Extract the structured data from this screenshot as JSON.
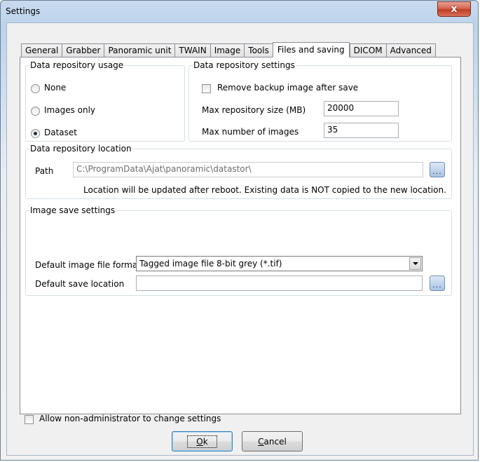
{
  "window": {
    "title": "Settings",
    "close_label": "x"
  },
  "tabs": [
    {
      "label": "General"
    },
    {
      "label": "Grabber"
    },
    {
      "label": "Panoramic unit"
    },
    {
      "label": "TWAIN"
    },
    {
      "label": "Image"
    },
    {
      "label": "Tools"
    },
    {
      "label": "Files and saving"
    },
    {
      "label": "DICOM"
    },
    {
      "label": "Advanced"
    }
  ],
  "active_tab": "Files and saving",
  "repo_usage": {
    "legend": "Data repository usage",
    "options": [
      {
        "label": "None",
        "selected": false
      },
      {
        "label": "Images only",
        "selected": false
      },
      {
        "label": "Dataset",
        "selected": true
      }
    ]
  },
  "repo_settings": {
    "legend": "Data repository settings",
    "remove_backup_label": "Remove backup image after save",
    "remove_backup_checked": false,
    "max_size_label": "Max repository size (MB)",
    "max_size_value": "20000",
    "max_images_label": "Max number of images",
    "max_images_value": "35"
  },
  "repo_location": {
    "legend": "Data repository location",
    "path_label": "Path",
    "path_value": "C:\\ProgramData\\Ajat\\panoramic\\datastor\\",
    "browse_label": "...",
    "note": "Location will be updated after reboot. Existing data is NOT copied to the new location."
  },
  "image_save": {
    "legend": "Image save settings",
    "format_label": "Default image file format",
    "format_value": "Tagged image file 8-bit grey (*.tif)",
    "location_label": "Default save location",
    "location_value": "",
    "browse_label": "..."
  },
  "footer": {
    "allow_nonadmin_label": "Allow non-administrator to change settings",
    "allow_nonadmin_checked": false,
    "ok_mnemonic": "O",
    "ok_rest": "k",
    "cancel_mnemonic": "C",
    "cancel_rest": "ancel"
  },
  "colors": {
    "title_gradient_top": "#c8daee",
    "close_button": "#c23c24",
    "tab_border": "#898c95",
    "group_border": "#d5dfe5"
  }
}
